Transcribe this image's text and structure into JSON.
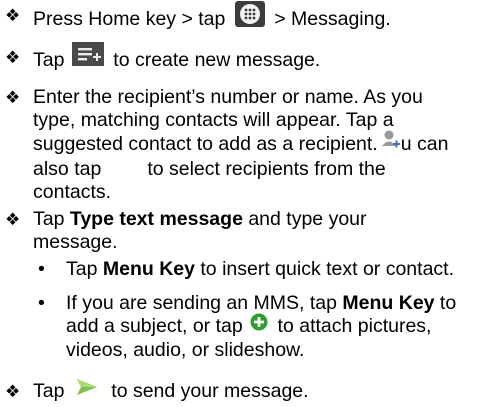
{
  "bullet_glyph": "❖",
  "sub_bullet_glyph": "•",
  "steps": [
    {
      "pre": "Press Home key > tap ",
      "post": " > Messaging.",
      "icon": "apps-grid-icon"
    },
    {
      "pre": "Tap ",
      "post": " to create new message.",
      "icon": "new-message-icon"
    },
    {
      "line1": "Enter the recipient’s number or name. As you",
      "line2": "type, matching contacts will appear. Tap a",
      "line3a": "suggested contact to add as a recipient.",
      "line3b": "u can",
      "line4a": "also tap",
      "line4b": "to select recipients from the",
      "line5": "contacts.",
      "icon": "add-contact-icon"
    },
    {
      "pre": "Tap ",
      "bold": "Type text message",
      "post": " and type your",
      "line2": "message."
    },
    {
      "pre": "Tap ",
      "post": " to send your message.",
      "icon": "send-icon"
    }
  ],
  "substeps": [
    {
      "pre": "Tap ",
      "bold": "Menu Key",
      "post": " to insert quick text or contact."
    },
    {
      "pre": "If you are sending an MMS, tap ",
      "bold": "Menu Key",
      "post": " to",
      "line2a": "add a subject, or tap ",
      "line2b": " to attach pictures,",
      "line3": "videos, audio, or slideshow.",
      "icon": "add-attachment-icon"
    }
  ],
  "colors": {
    "icon_dark": "#4a4a4a",
    "accent_green": "#2e9e2e",
    "send_green": "#7cc24a"
  }
}
